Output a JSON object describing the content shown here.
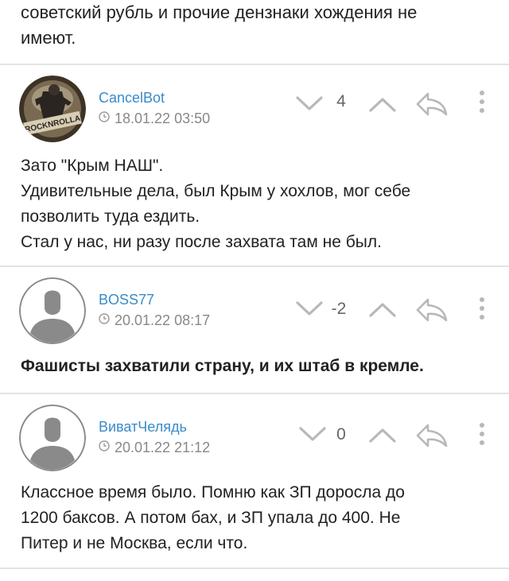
{
  "top_text": [
    "советский рубль и прочие дензнаки хождения не",
    "имеют."
  ],
  "comments": [
    {
      "username": "CancelBot",
      "date": "18.01.22 03:50",
      "score": "4",
      "avatar_text": "ROCKNROLLA",
      "lines": [
        "Зато \"Крым НАШ\".",
        "Удивительные дела, был Крым у хохлов, мог себе",
        "позволить туда ездить.",
        "Стал у нас, ни разу после захвата там не был."
      ]
    },
    {
      "username": "BOSS77",
      "date": "20.01.22 08:17",
      "score": "-2",
      "lines": [
        "Фашисты захватили страну, и их штаб в кремле."
      ]
    },
    {
      "username": "ВиватЧелядь",
      "date": "20.01.22 21:12",
      "score": "0",
      "lines": [
        "Классное время было. Помню как ЗП доросла до",
        "1200 баксов. А потом бах, и ЗП упала до 400. Не",
        "Питер и не Москва, если что."
      ]
    }
  ],
  "colors": {
    "username": "#3a8bc8",
    "muted": "#888888",
    "icon": "#b8b8b8",
    "divider": "#e3e3e3"
  },
  "icons": [
    "clock-icon",
    "chevron-down-icon",
    "chevron-up-icon",
    "reply-icon",
    "more-icon"
  ]
}
